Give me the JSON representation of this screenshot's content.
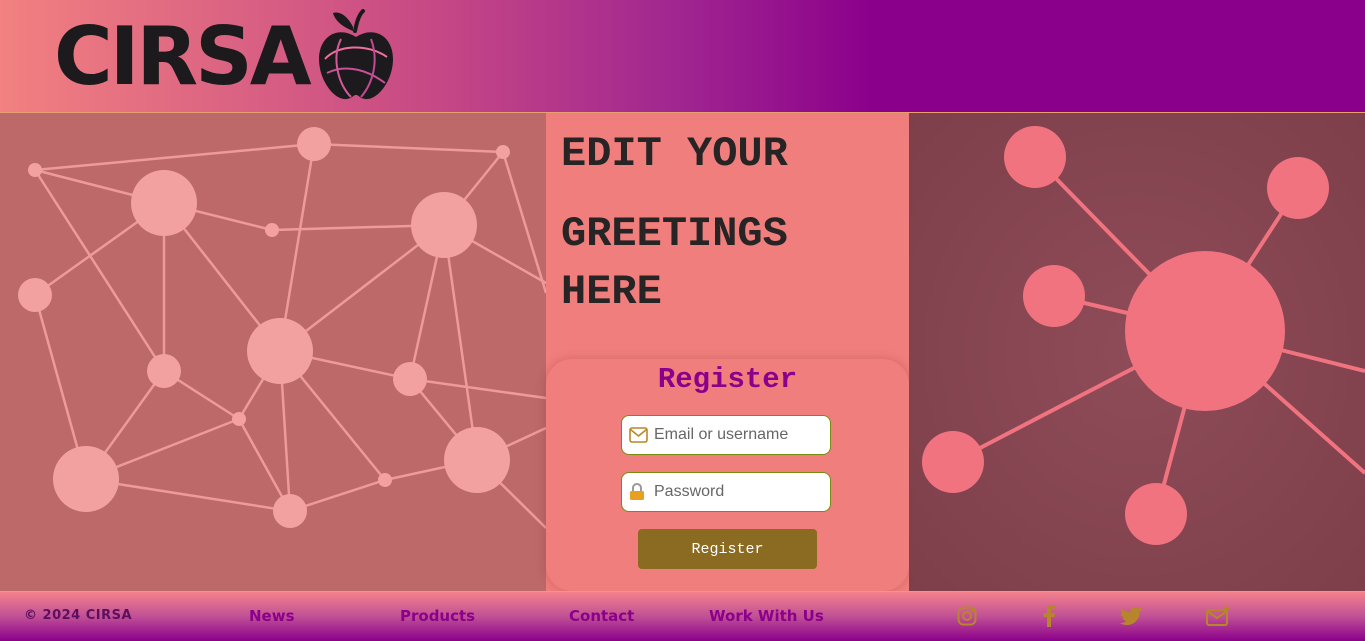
{
  "header": {
    "logo_text": "CIRSA",
    "logo_icon": "apple-icon"
  },
  "main": {
    "greeting_line1": "EDIT YOUR",
    "greeting_line2": "GREETINGS HERE",
    "register": {
      "title": "Register",
      "email_placeholder": "Email or username",
      "email_icon": "envelope-icon",
      "password_placeholder": "Password",
      "password_icon": "lock-icon",
      "button_label": "Register"
    }
  },
  "footer": {
    "copyright": "© 2024 CIRSA",
    "links": [
      {
        "label": "News"
      },
      {
        "label": "Products"
      },
      {
        "label": "Contact"
      },
      {
        "label": "Work With Us"
      }
    ],
    "social": [
      "instagram-icon",
      "facebook-icon",
      "twitter-icon",
      "mail-plus-icon"
    ]
  },
  "colors": {
    "brand_purple": "#8b008b",
    "salmon": "#f07e7c",
    "button_brown": "#8b6a21",
    "icon_gold": "#b8862a"
  }
}
